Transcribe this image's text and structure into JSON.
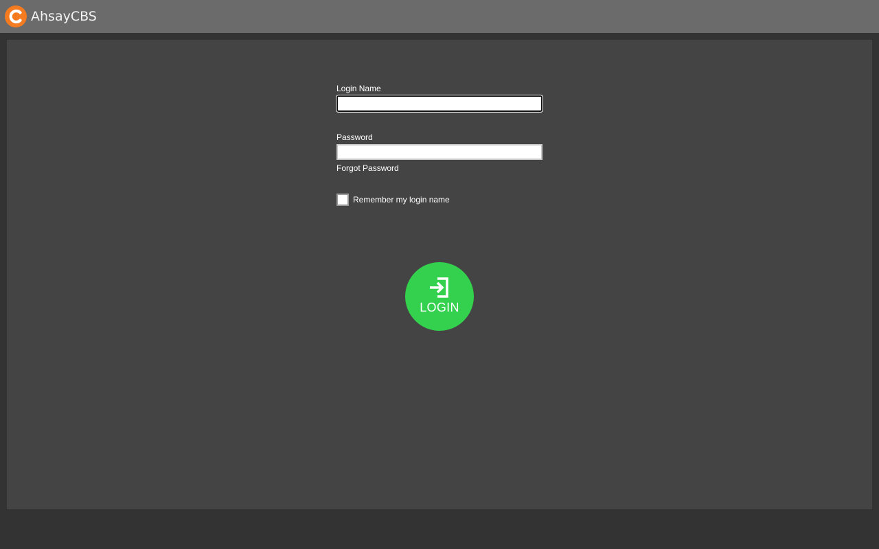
{
  "app": {
    "brand_name": "AhsayCBS",
    "logo_color": "#f47b20"
  },
  "login": {
    "login_name_label": "Login Name",
    "login_name_value": "",
    "password_label": "Password",
    "password_value": "",
    "forgot_password": "Forgot Password",
    "remember_label": "Remember my login name",
    "remember_checked": false,
    "submit_label": "LOGIN",
    "submit_icon": "sign-in-icon",
    "submit_color": "#34d14f"
  }
}
